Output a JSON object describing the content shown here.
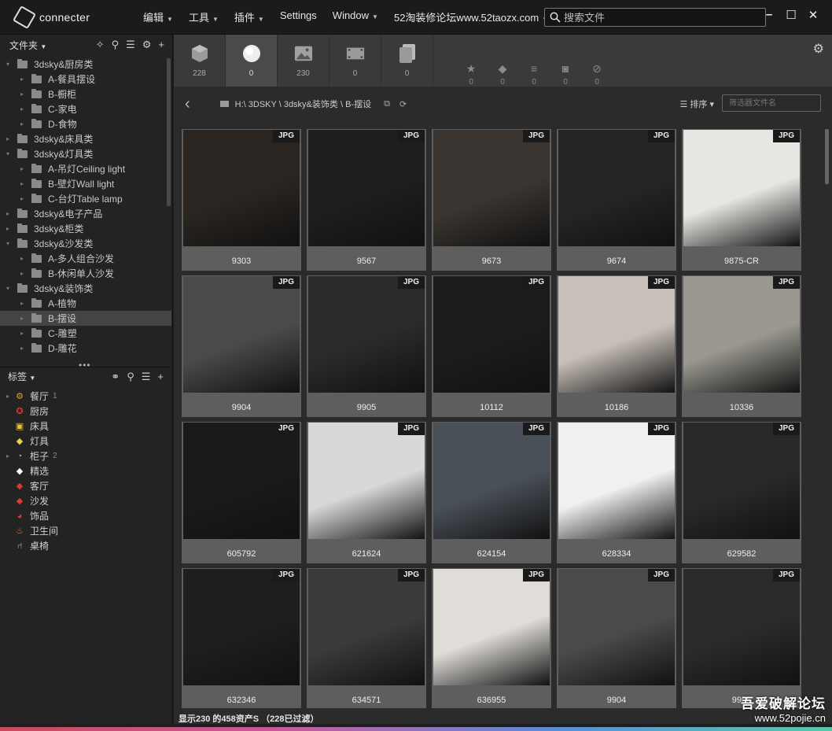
{
  "app": {
    "name": "connecter"
  },
  "menu": [
    {
      "label": "编辑",
      "caret": true
    },
    {
      "label": "工具",
      "caret": true
    },
    {
      "label": "插件",
      "caret": true
    },
    {
      "label": "Settings",
      "caret": false
    },
    {
      "label": "Window",
      "caret": true
    },
    {
      "label": "52淘装修论坛www.52taozx.com",
      "caret": true
    }
  ],
  "search": {
    "placeholder": "搜索文件"
  },
  "sidebar": {
    "folders_label": "文件夹",
    "tree": [
      {
        "label": "3dsky&厨房类",
        "level": 0,
        "expanded": true
      },
      {
        "label": "A-餐具摆设",
        "level": 1
      },
      {
        "label": "B-橱柜",
        "level": 1
      },
      {
        "label": "C-家电",
        "level": 1
      },
      {
        "label": "D-食物",
        "level": 1
      },
      {
        "label": "3dsky&床具类",
        "level": 0
      },
      {
        "label": "3dsky&灯具类",
        "level": 0,
        "expanded": true
      },
      {
        "label": "A-吊灯Ceiling light",
        "level": 1
      },
      {
        "label": "B-壁灯Wall light",
        "level": 1
      },
      {
        "label": "C-台灯Table lamp",
        "level": 1
      },
      {
        "label": "3dsky&电子产品",
        "level": 0
      },
      {
        "label": "3dsky&柜类",
        "level": 0
      },
      {
        "label": "3dsky&沙发类",
        "level": 0,
        "expanded": true
      },
      {
        "label": "A-多人组合沙发",
        "level": 1
      },
      {
        "label": "B-休闲单人沙发",
        "level": 1
      },
      {
        "label": "3dsky&装饰类",
        "level": 0,
        "expanded": true
      },
      {
        "label": "A-植物",
        "level": 1
      },
      {
        "label": "B-摆设",
        "level": 1,
        "selected": true
      },
      {
        "label": "C-雕塑",
        "level": 1
      },
      {
        "label": "D-雕花",
        "level": 1
      }
    ],
    "tags_label": "标签",
    "tags": [
      {
        "label": "餐厅",
        "count": "1",
        "icon": "gear-icon",
        "color": "#e8a030"
      },
      {
        "label": "厨房",
        "count": "",
        "icon": "badge-icon",
        "color": "#d83a3a"
      },
      {
        "label": "床具",
        "count": "",
        "icon": "image-icon",
        "color": "#e8c040"
      },
      {
        "label": "灯具",
        "count": "",
        "icon": "tag-icon",
        "color": "#e8d050"
      },
      {
        "label": "柜子",
        "count": "2",
        "icon": "pie-icon",
        "color": "#aaaaaa"
      },
      {
        "label": "精选",
        "count": "",
        "icon": "tag-icon",
        "color": "#ffffff"
      },
      {
        "label": "客厅",
        "count": "",
        "icon": "tag-icon",
        "color": "#d83a3a"
      },
      {
        "label": "沙发",
        "count": "",
        "icon": "tag-icon",
        "color": "#d83a3a"
      },
      {
        "label": "饰品",
        "count": "",
        "icon": "pacman-icon",
        "color": "#d83a3a"
      },
      {
        "label": "卫生间",
        "count": "",
        "icon": "bathtub-icon",
        "color": "#e87a3a"
      },
      {
        "label": "桌椅",
        "count": "",
        "icon": "chair-icon",
        "color": "#e8c0a0"
      }
    ]
  },
  "type_tabs": [
    {
      "name": "model",
      "count": "228"
    },
    {
      "name": "material",
      "count": "0"
    },
    {
      "name": "image",
      "count": "230"
    },
    {
      "name": "video",
      "count": "0"
    },
    {
      "name": "document",
      "count": "0"
    }
  ],
  "filters": [
    {
      "name": "star",
      "count": "0"
    },
    {
      "name": "tag",
      "count": "0"
    },
    {
      "name": "text",
      "count": "0"
    },
    {
      "name": "camera",
      "count": "0"
    },
    {
      "name": "block",
      "count": "0"
    }
  ],
  "pathbar": {
    "path": "H:\\ 3DSKY \\ 3dsky&装饰类 \\ B-摆设",
    "sort_label": "排序",
    "filter_placeholder": "筛选器文件名"
  },
  "grid": {
    "badge": "JPG",
    "items": [
      {
        "name": "9303",
        "tone": "#2a2520"
      },
      {
        "name": "9567",
        "tone": "#1e1e1e"
      },
      {
        "name": "9673",
        "tone": "#3a3530"
      },
      {
        "name": "9674",
        "tone": "#252525"
      },
      {
        "name": "9875-CR",
        "tone": "#e8e6e2"
      },
      {
        "name": "9904",
        "tone": "#4a4a48"
      },
      {
        "name": "9905",
        "tone": "#2a2a28"
      },
      {
        "name": "10112",
        "tone": "#1c1c1c"
      },
      {
        "name": "10186",
        "tone": "#c8c0b8"
      },
      {
        "name": "10336",
        "tone": "#9a9890"
      },
      {
        "name": "605792",
        "tone": "#1a1a18"
      },
      {
        "name": "621624",
        "tone": "#d8d8d8"
      },
      {
        "name": "624154",
        "tone": "#4a5058"
      },
      {
        "name": "628334",
        "tone": "#f0f0f0"
      },
      {
        "name": "629582",
        "tone": "#2a2828"
      },
      {
        "name": "632346",
        "tone": "#1e1e1e"
      },
      {
        "name": "634571",
        "tone": "#3a3a38"
      },
      {
        "name": "636955",
        "tone": "#e0ddd8"
      },
      {
        "name": "9904",
        "tone": "#4a4a48"
      },
      {
        "name": "9905",
        "tone": "#2a2a28"
      }
    ]
  },
  "status": "显示230 的458资产S （228已过滤）",
  "watermark": {
    "line1": "吾爱破解论坛",
    "line2": "www.52pojie.cn"
  }
}
